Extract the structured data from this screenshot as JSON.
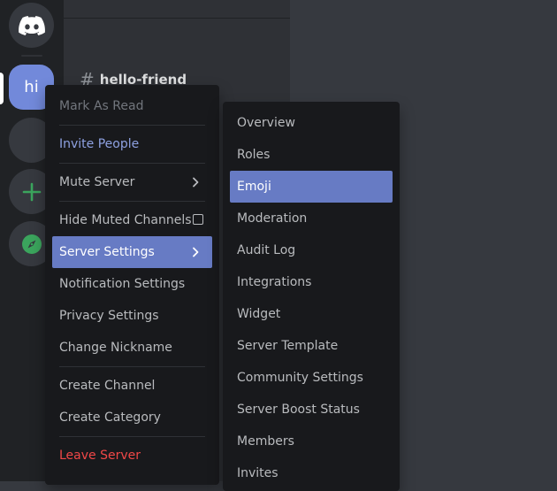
{
  "servers": {
    "home_icon": "discord-logo-icon",
    "active_server_label": "hi",
    "add_icon": "plus-icon",
    "explore_icon": "compass-icon"
  },
  "channel": {
    "name": "hello-friend",
    "icon": "hash-icon"
  },
  "context_menu": {
    "mark_as_read": "Mark As Read",
    "invite_people": "Invite People",
    "mute_server": "Mute Server",
    "hide_muted_channels": "Hide Muted Channels",
    "server_settings": "Server Settings",
    "notification_settings": "Notification Settings",
    "privacy_settings": "Privacy Settings",
    "change_nickname": "Change Nickname",
    "create_channel": "Create Channel",
    "create_category": "Create Category",
    "leave_server": "Leave Server"
  },
  "settings_submenu": {
    "items": [
      "Overview",
      "Roles",
      "Emoji",
      "Moderation",
      "Audit Log",
      "Integrations",
      "Widget",
      "Server Template",
      "Community Settings",
      "Server Boost Status",
      "Members",
      "Invites"
    ],
    "selected": "Emoji"
  },
  "colors": {
    "accent": "#677bc4",
    "invite_blue": "#8ea1e1",
    "danger_red": "#f04747",
    "add_green": "#3ba55d"
  }
}
